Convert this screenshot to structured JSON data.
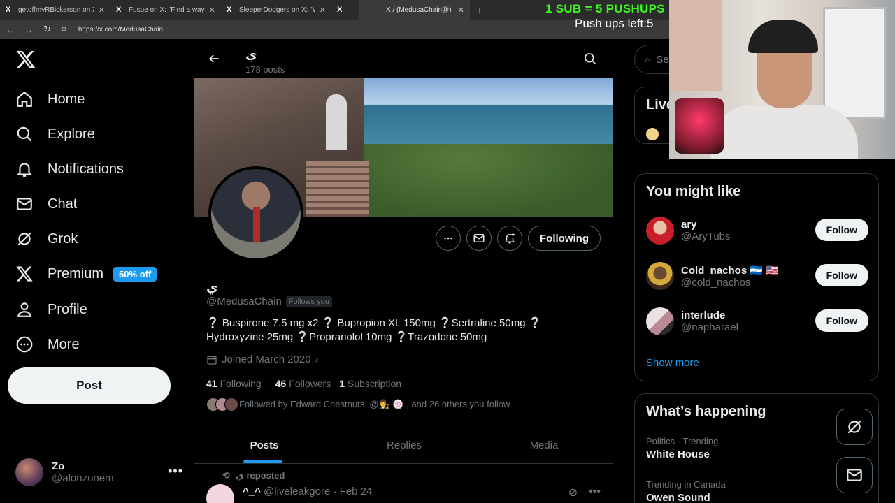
{
  "browser": {
    "tabs": [
      {
        "title": "getoffmyRBickerson on X: \"This",
        "active": false
      },
      {
        "title": "Fusue on X: \"Find a way to draft",
        "active": false
      },
      {
        "title": "SleeperDodgers on X: \"What a",
        "active": false
      },
      {
        "title": "",
        "active": false
      },
      {
        "title": "X / (MedusaChain@) ي",
        "active": true
      }
    ],
    "url": "https://x.com/MedusaChain"
  },
  "overlay": {
    "title": "1 SUB = 5 PUSHUPS",
    "subtitle": "Push ups left:5"
  },
  "nav": {
    "items": [
      {
        "label": "Home",
        "icon": "home-icon"
      },
      {
        "label": "Explore",
        "icon": "search-icon"
      },
      {
        "label": "Notifications",
        "icon": "bell-icon"
      },
      {
        "label": "Chat",
        "icon": "mail-icon"
      },
      {
        "label": "Grok",
        "icon": "grok-icon"
      },
      {
        "label": "Premium",
        "icon": "x-logo-icon"
      },
      {
        "label": "Profile",
        "icon": "person-icon"
      },
      {
        "label": "More",
        "icon": "more-circle-icon"
      }
    ],
    "premium_badge": "50% off",
    "post_label": "Post",
    "account": {
      "name": "Zo",
      "handle": "@alonzonem"
    }
  },
  "profile": {
    "name": "ي",
    "posts_count": "178 posts",
    "handle": "@MedusaChain",
    "follows_you": "Follows you",
    "bio_line1": "❔ Buspirone 7.5 mg x2 ❔ Bupropion XL 150mg ❔Sertraline 50mg ❔",
    "bio_line2": "Hydroxyzine 25mg ❔Propranolol 10mg ❔Trazodone 50mg",
    "joined": "Joined March 2020",
    "following_count": "41",
    "following_label": "Following",
    "followers_count": "46",
    "followers_label": "Followers",
    "subs_count": "1",
    "subs_label": "Subscription",
    "followed_by": "Followed by Edward Chestnuts, @👨‍⚖️ 🍥 , and 26 others you follow",
    "following_button": "Following",
    "tabs": [
      "Posts",
      "Replies",
      "Media"
    ],
    "repost_label": "ي reposted",
    "tweet_name": "^_^",
    "tweet_meta": "@liveleakgore · Feb 24"
  },
  "right": {
    "search_placeholder": "Se",
    "live_title": "Live",
    "you_might_like": "You might like",
    "suggestions": [
      {
        "name": "ary",
        "handle": "@AryTubs",
        "button": "Follow"
      },
      {
        "name": "Cold_nachos 🇳🇮 🇺🇸",
        "handle": "@cold_nachos",
        "button": "Follow"
      },
      {
        "name": "interlude",
        "handle": "@napharael",
        "button": "Follow"
      }
    ],
    "show_more": "Show more",
    "whats_happening": "What’s happening",
    "trends": [
      {
        "category": "Politics · Trending",
        "title": "White House"
      },
      {
        "category": "Trending in Canada",
        "title": "Owen Sound"
      }
    ]
  },
  "colors": {
    "accent": "#1d9bf0",
    "overlay_green": "#3df51f"
  }
}
